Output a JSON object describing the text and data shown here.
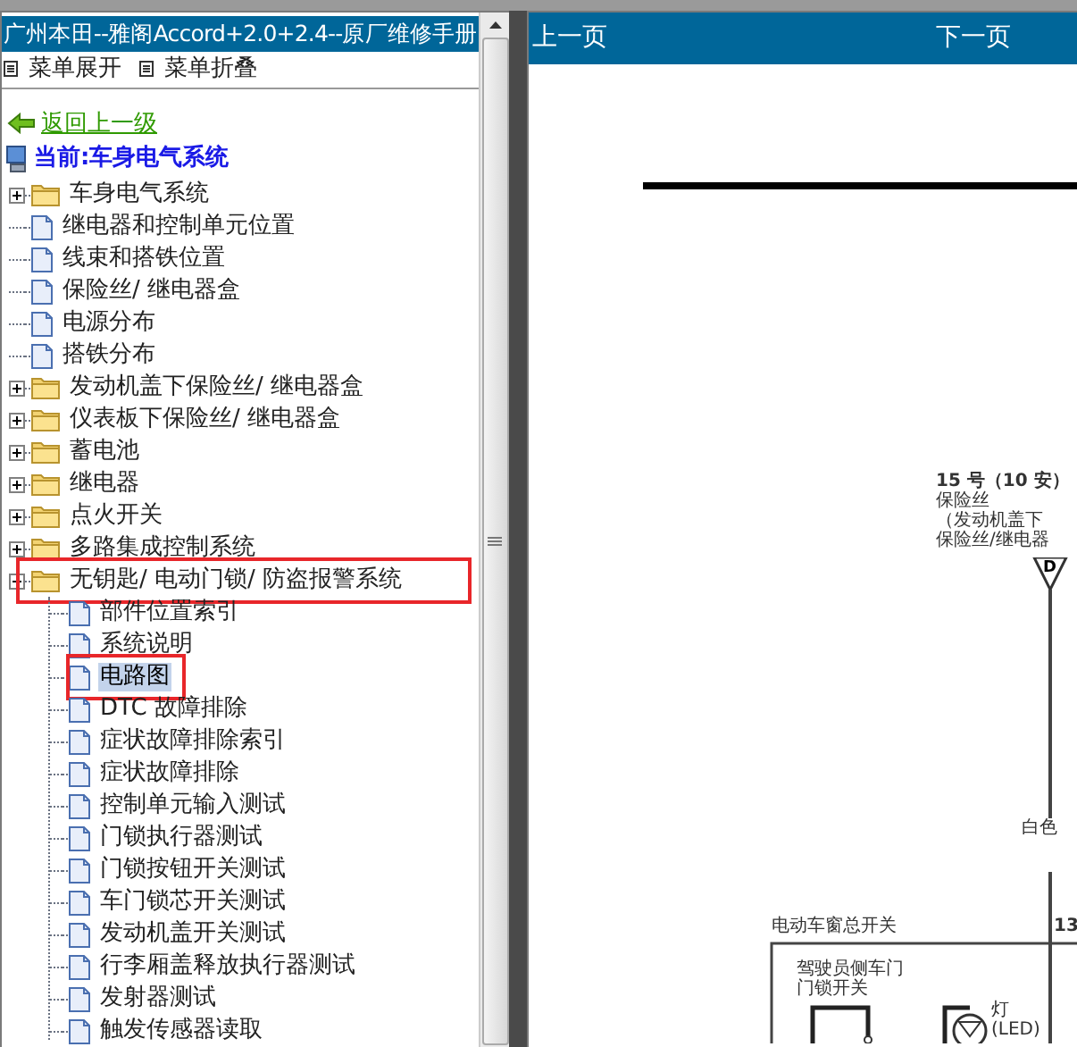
{
  "window": {
    "title": "广州本田--雅阁Accord+2.0+2.4--原厂维修手册"
  },
  "menu": [
    {
      "label": "菜单展开"
    },
    {
      "label": "菜单折叠"
    }
  ],
  "back_link": "返回上一级",
  "current": "当前:车身电气系统",
  "tree": [
    {
      "label": "车身电气系统",
      "kind": "folder",
      "expanded": false,
      "selected": false,
      "highlighted": false
    },
    {
      "label": "继电器和控制单元位置",
      "kind": "page",
      "selected": false,
      "highlighted": false
    },
    {
      "label": "线束和搭铁位置",
      "kind": "page",
      "selected": false,
      "highlighted": false
    },
    {
      "label": "保险丝/ 继电器盒",
      "kind": "page",
      "selected": false,
      "highlighted": false
    },
    {
      "label": "电源分布",
      "kind": "page",
      "selected": false,
      "highlighted": false
    },
    {
      "label": "搭铁分布",
      "kind": "page",
      "selected": false,
      "highlighted": false
    },
    {
      "label": "发动机盖下保险丝/ 继电器盒",
      "kind": "folder",
      "expanded": false,
      "selected": false,
      "highlighted": false
    },
    {
      "label": "仪表板下保险丝/ 继电器盒",
      "kind": "folder",
      "expanded": false,
      "selected": false,
      "highlighted": false
    },
    {
      "label": "蓄电池",
      "kind": "folder",
      "expanded": false,
      "selected": false,
      "highlighted": false
    },
    {
      "label": "继电器",
      "kind": "folder",
      "expanded": false,
      "selected": false,
      "highlighted": false
    },
    {
      "label": "点火开关",
      "kind": "folder",
      "expanded": false,
      "selected": false,
      "highlighted": false
    },
    {
      "label": "多路集成控制系统",
      "kind": "folder",
      "expanded": false,
      "selected": false,
      "highlighted": false
    },
    {
      "label": "无钥匙/ 电动门锁/ 防盗报警系统",
      "kind": "folder",
      "expanded": true,
      "selected": false,
      "highlighted": true,
      "children": [
        {
          "label": "部件位置索引",
          "kind": "page",
          "selected": false,
          "highlighted": false
        },
        {
          "label": "系统说明",
          "kind": "page",
          "selected": false,
          "highlighted": false
        },
        {
          "label": "电路图",
          "kind": "page",
          "selected": true,
          "highlighted": true
        },
        {
          "label": "DTC 故障排除",
          "kind": "page",
          "selected": false,
          "highlighted": false
        },
        {
          "label": "症状故障排除索引",
          "kind": "page",
          "selected": false,
          "highlighted": false
        },
        {
          "label": "症状故障排除",
          "kind": "page",
          "selected": false,
          "highlighted": false
        },
        {
          "label": "控制单元输入测试",
          "kind": "page",
          "selected": false,
          "highlighted": false
        },
        {
          "label": "门锁执行器测试",
          "kind": "page",
          "selected": false,
          "highlighted": false
        },
        {
          "label": "门锁按钮开关测试",
          "kind": "page",
          "selected": false,
          "highlighted": false
        },
        {
          "label": "车门锁芯开关测试",
          "kind": "page",
          "selected": false,
          "highlighted": false
        },
        {
          "label": "发动机盖开关测试",
          "kind": "page",
          "selected": false,
          "highlighted": false
        },
        {
          "label": "行李厢盖释放执行器测试",
          "kind": "page",
          "selected": false,
          "highlighted": false
        },
        {
          "label": "发射器测试",
          "kind": "page",
          "selected": false,
          "highlighted": false
        },
        {
          "label": "触发传感器读取",
          "kind": "page",
          "selected": false,
          "highlighted": false
        }
      ]
    }
  ],
  "pager": {
    "prev": "上一页",
    "next": "下一页"
  },
  "diagram": {
    "fuse_label": [
      "15 号（10 安）",
      "保险丝",
      "（发动机盖下",
      "保险丝/继电器"
    ],
    "connector": "D",
    "wire_color": "白色",
    "switch_title": "电动车窗总开关",
    "pin": "13",
    "door_switch": [
      "驾驶员侧车门",
      "门锁开关"
    ],
    "lamp": [
      "灯",
      "(LED)"
    ]
  }
}
